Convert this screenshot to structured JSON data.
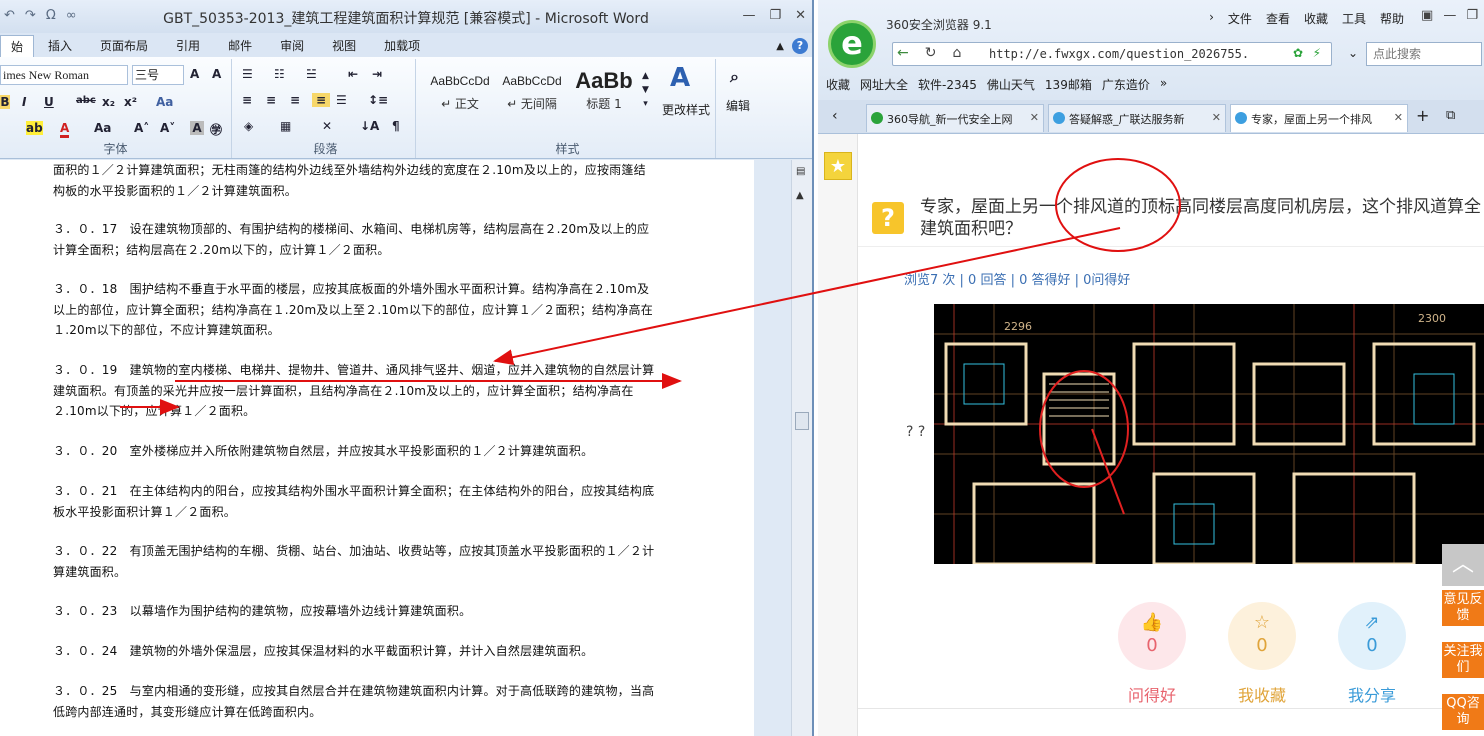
{
  "word": {
    "window_title": "GBT_50353-2013_建筑工程建筑面积计算规范 [兼容模式] - Microsoft Word",
    "tabs": [
      "始",
      "插入",
      "页面布局",
      "引用",
      "邮件",
      "审阅",
      "视图",
      "加载项"
    ],
    "font_name": "imes New Roman",
    "font_size": "三号",
    "styles": [
      {
        "sample": "AaBbCcDd",
        "name": "↵ 正文"
      },
      {
        "sample": "AaBbCcDd",
        "name": "↵ 无间隔"
      },
      {
        "sample": "AaBb",
        "name": "标题 1"
      }
    ],
    "change_styles": "更改样式",
    "edit": "编辑",
    "groups": {
      "font": "字体",
      "paragraph": "段落",
      "styles": "样式"
    },
    "paragraphs": [
      "面积的１／２计算建筑面积；无柱雨篷的结构外边线至外墙结构外边线的宽度在２.10m及以上的，应按雨篷结构板的水平投影面积的１／２计算建筑面积。",
      "３．０．17　设在建筑物顶部的、有围护结构的楼梯间、水箱间、电梯机房等，结构层高在２.20m及以上的应计算全面积；结构层高在２.20m以下的，应计算１／２面积。",
      "３．０．18　围护结构不垂直于水平面的楼层，应按其底板面的外墙外围水平面积计算。结构净高在２.10m及以上的部位，应计算全面积；结构净高在１.20m及以上至２.10m以下的部位，应计算１／２面积；结构净高在１.20m以下的部位，不应计算建筑面积。",
      "３．０．19　建筑物的室内楼梯、电梯井、提物井、管道井、通风排气竖井、烟道，应并入建筑物的自然层计算建筑面积。有顶盖的采光井应按一层计算面积，且结构净高在２.10m及以上的，应计算全面积；结构净高在２.10m以下的，应计算１／２面积。",
      "３．０．20　室外楼梯应并入所依附建筑物自然层，并应按其水平投影面积的１／２计算建筑面积。",
      "３．０．21　在主体结构内的阳台，应按其结构外围水平面积计算全面积；在主体结构外的阳台，应按其结构底板水平投影面积计算１／２面积。",
      "３．０．22　有顶盖无围护结构的车棚、货棚、站台、加油站、收费站等，应按其顶盖水平投影面积的１／２计算建筑面积。",
      "３．０．23　以幕墙作为围护结构的建筑物，应按幕墙外边线计算建筑面积。",
      "３．０．24　建筑物的外墙外保温层，应按其保温材料的水平截面积计算，并计入自然层建筑面积。",
      "３．０．25　与室内相通的变形缝，应按其自然层合并在建筑物建筑面积内计算。对于高低联跨的建筑物，当高低跨内部连通时，其变形缝应计算在低跨面积内。"
    ]
  },
  "browser": {
    "name": "360安全浏览器 9.1",
    "menu": [
      "文件",
      "查看",
      "收藏",
      "工具",
      "帮助"
    ],
    "url": "http://e.fwxgx.com/question_2026755.",
    "search_placeholder": "点此搜索",
    "favorites": [
      "收藏",
      "网址大全",
      "软件-2345",
      "佛山天气",
      "139邮箱",
      "广东造价"
    ],
    "tabs": [
      {
        "title": "360导航_新一代安全上网"
      },
      {
        "title": "答疑解惑_广联达服务新"
      },
      {
        "title": "专家，屋面上另一个排风"
      }
    ],
    "question": "专家，屋面上另一个排风道的顶标高同楼层高度同机房层，这个排风道算全建筑面积吧？",
    "stats": "浏览7 次 | 0 回答 | 0 答得好 | 0问得好",
    "qq_text": "? ?",
    "cad_labels": [
      "2296",
      "2300"
    ],
    "actions": [
      {
        "label": "问得好",
        "count": "0",
        "icon": "thumb-icon",
        "color": "#e8646e"
      },
      {
        "label": "我收藏",
        "count": "0",
        "icon": "star-icon",
        "color": "#e0a43a"
      },
      {
        "label": "我分享",
        "count": "0",
        "icon": "share-icon",
        "color": "#3a9bd8"
      }
    ],
    "side_buttons": [
      "意见反馈",
      "关注我们",
      "QQ咨询"
    ]
  }
}
